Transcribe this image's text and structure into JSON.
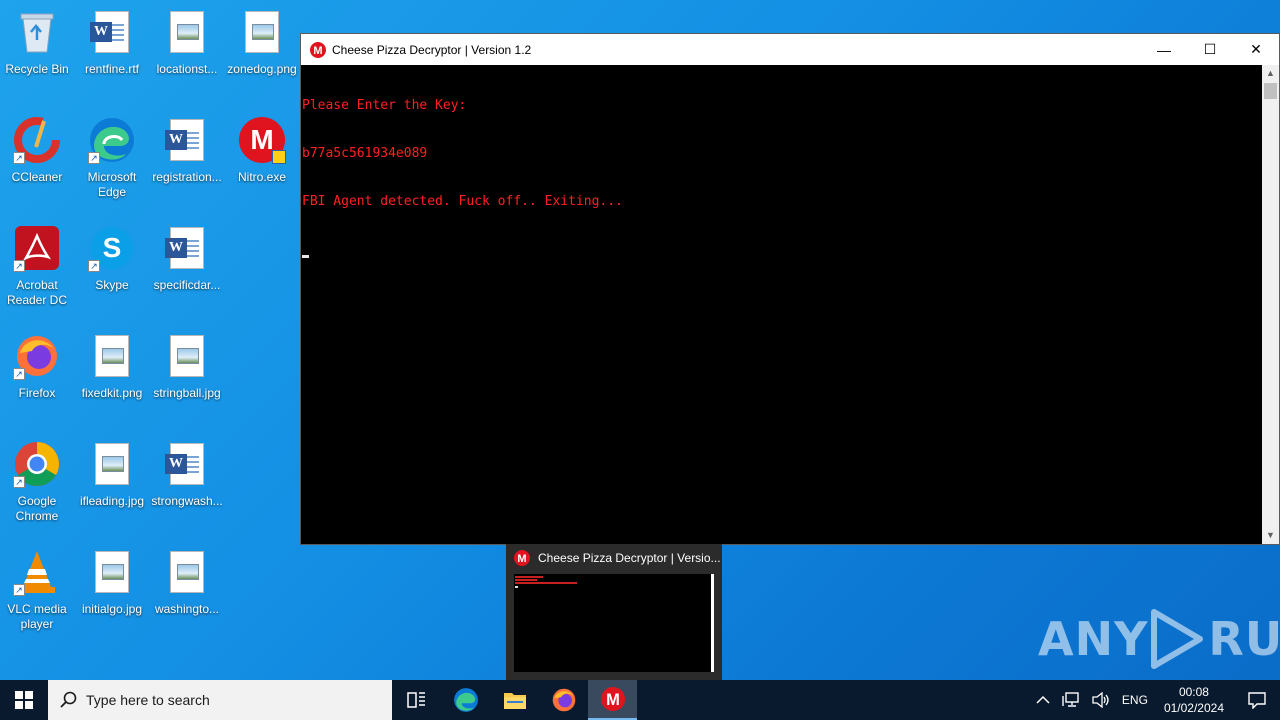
{
  "desktop": {
    "icons": [
      {
        "label": "Recycle Bin"
      },
      {
        "label": "rentfine.rtf"
      },
      {
        "label": "locationst..."
      },
      {
        "label": "zonedog.png"
      },
      {
        "label": "CCleaner"
      },
      {
        "label": "Microsoft Edge"
      },
      {
        "label": "registration..."
      },
      {
        "label": "Nitro.exe"
      },
      {
        "label": "Acrobat Reader DC"
      },
      {
        "label": "Skype"
      },
      {
        "label": "specificdar..."
      },
      {
        "label": "Firefox"
      },
      {
        "label": "fixedkit.png"
      },
      {
        "label": "stringball.jpg"
      },
      {
        "label": "Google Chrome"
      },
      {
        "label": "ifleading.jpg"
      },
      {
        "label": "strongwash..."
      },
      {
        "label": "VLC media player"
      },
      {
        "label": "initialgo.jpg"
      },
      {
        "label": "washingto..."
      }
    ]
  },
  "console_window": {
    "title": "Cheese Pizza Decryptor | Version 1.2",
    "lines": [
      "Please Enter the Key:",
      "b77a5c561934e089",
      "FBI Agent detected. Fuck off.. Exiting..."
    ],
    "text_color": "#ff2020"
  },
  "preview": {
    "title": "Cheese Pizza Decryptor | Versio..."
  },
  "watermark": {
    "text_left": "ANY",
    "text_right": "RUN"
  },
  "taskbar": {
    "search_placeholder": "Type here to search",
    "tray": {
      "language": "ENG",
      "time": "00:08",
      "date": "01/02/2024"
    }
  }
}
